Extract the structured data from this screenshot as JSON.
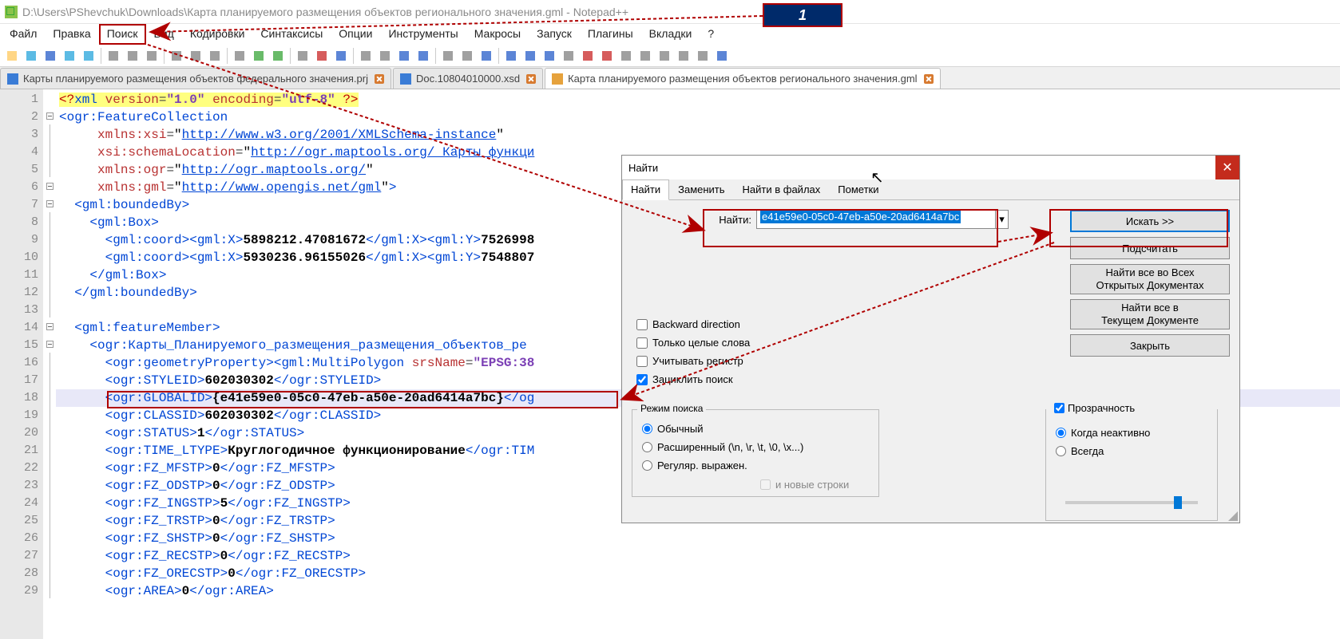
{
  "title": "D:\\Users\\PShevchuk\\Downloads\\Карта планируемого размещения объектов регионального значения.gml - Notepad++",
  "callout_label": "1",
  "menubar": [
    "Файл",
    "Правка",
    "Поиск",
    "Вид",
    "Кодировки",
    "Синтаксисы",
    "Опции",
    "Инструменты",
    "Макросы",
    "Запуск",
    "Плагины",
    "Вкладки",
    "?"
  ],
  "tabs": [
    {
      "label": "Карты планируемого размещения объектов федерального значения.prj",
      "active": false,
      "icon": "blue"
    },
    {
      "label": "Doc.10804010000.xsd",
      "active": false,
      "icon": "blue"
    },
    {
      "label": "Карта планируемого размещения объектов регионального значения.gml",
      "active": true,
      "icon": "orange"
    }
  ],
  "code": {
    "lines": [
      {
        "n": 1,
        "html": "<span class='t-pi-bg'><span class='t-pi'>&lt;?</span><span class='t-tag'>xml</span> <span class='t-attr'>version</span><span class='t-eq'>=</span><span class='t-str'>\"1.0\"</span> <span class='t-attr'>encoding</span><span class='t-eq'>=</span><span class='t-str'>\"utf-8\"</span> <span class='t-pi'>?&gt;</span></span>"
      },
      {
        "n": 2,
        "html": "<span class='t-tag'>&lt;ogr:FeatureCollection</span>"
      },
      {
        "n": 3,
        "html": "     <span class='t-attr'>xmlns:xsi</span><span class='t-eq'>=</span>\"<span class='t-url'>http://www.w3.org/2001/XMLSchema-instance</span>\""
      },
      {
        "n": 4,
        "html": "     <span class='t-attr'>xsi:schemaLocation</span><span class='t-eq'>=</span>\"<span class='t-url'>http://ogr.maptools.org/ Карты функци</span>"
      },
      {
        "n": 5,
        "html": "     <span class='t-attr'>xmlns:ogr</span><span class='t-eq'>=</span>\"<span class='t-url'>http://ogr.maptools.org/</span>\""
      },
      {
        "n": 6,
        "html": "     <span class='t-attr'>xmlns:gml</span><span class='t-eq'>=</span>\"<span class='t-url'>http://www.opengis.net/gml</span>\"<span class='t-tag'>&gt;</span>"
      },
      {
        "n": 7,
        "html": "  <span class='t-tag'>&lt;gml:boundedBy&gt;</span>"
      },
      {
        "n": 8,
        "html": "    <span class='t-tag'>&lt;gml:Box&gt;</span>"
      },
      {
        "n": 9,
        "html": "      <span class='t-tag'>&lt;gml:coord&gt;&lt;gml:X&gt;</span><span class='t-txt-b'>5898212.47081672</span><span class='t-tag'>&lt;/gml:X&gt;&lt;gml:Y&gt;</span><span class='t-txt-b'>7526998</span>"
      },
      {
        "n": 10,
        "html": "      <span class='t-tag'>&lt;gml:coord&gt;&lt;gml:X&gt;</span><span class='t-txt-b'>5930236.96155026</span><span class='t-tag'>&lt;/gml:X&gt;&lt;gml:Y&gt;</span><span class='t-txt-b'>7548807</span>"
      },
      {
        "n": 11,
        "html": "    <span class='t-tag'>&lt;/gml:Box&gt;</span>"
      },
      {
        "n": 12,
        "html": "  <span class='t-tag'>&lt;/gml:boundedBy&gt;</span>"
      },
      {
        "n": 13,
        "html": ""
      },
      {
        "n": 14,
        "html": "  <span class='t-tag'>&lt;gml:featureMember&gt;</span>"
      },
      {
        "n": 15,
        "html": "    <span class='t-tag'>&lt;ogr:Карты_Планируемого_размещения_размещения_объектов_ре</span>"
      },
      {
        "n": 16,
        "html": "      <span class='t-tag'>&lt;ogr:geometryProperty&gt;&lt;gml:MultiPolygon</span> <span class='t-attr'>srsName</span><span class='t-eq'>=</span><span class='t-str'>\"EPSG:38</span>"
      },
      {
        "n": 17,
        "html": "      <span class='t-tag'>&lt;ogr:STYLEID&gt;</span><span class='t-txt-b'>602030302</span><span class='t-tag'>&lt;/ogr:STYLEID&gt;</span>"
      },
      {
        "n": 18,
        "html": "      <span class='t-tag'>&lt;ogr:GLOBALID&gt;</span><span class='t-txt-b'>{e41e59e0-05c0-47eb-a50e-20ad6414a7bc}</span><span class='t-tag'>&lt;/og</span>"
      },
      {
        "n": 19,
        "html": "      <span class='t-tag'>&lt;ogr:CLASSID&gt;</span><span class='t-txt-b'>602030302</span><span class='t-tag'>&lt;/ogr:CLASSID&gt;</span>"
      },
      {
        "n": 20,
        "html": "      <span class='t-tag'>&lt;ogr:STATUS&gt;</span><span class='t-txt-b'>1</span><span class='t-tag'>&lt;/ogr:STATUS&gt;</span>"
      },
      {
        "n": 21,
        "html": "      <span class='t-tag'>&lt;ogr:TIME_LTYPE&gt;</span><span class='t-txt-b'>Круглогодичное функционирование</span><span class='t-tag'>&lt;/ogr:TIM</span>"
      },
      {
        "n": 22,
        "html": "      <span class='t-tag'>&lt;ogr:FZ_MFSTP&gt;</span><span class='t-txt-b'>0</span><span class='t-tag'>&lt;/ogr:FZ_MFSTP&gt;</span>"
      },
      {
        "n": 23,
        "html": "      <span class='t-tag'>&lt;ogr:FZ_ODSTP&gt;</span><span class='t-txt-b'>0</span><span class='t-tag'>&lt;/ogr:FZ_ODSTP&gt;</span>"
      },
      {
        "n": 24,
        "html": "      <span class='t-tag'>&lt;ogr:FZ_INGSTP&gt;</span><span class='t-txt-b'>5</span><span class='t-tag'>&lt;/ogr:FZ_INGSTP&gt;</span>"
      },
      {
        "n": 25,
        "html": "      <span class='t-tag'>&lt;ogr:FZ_TRSTP&gt;</span><span class='t-txt-b'>0</span><span class='t-tag'>&lt;/ogr:FZ_TRSTP&gt;</span>"
      },
      {
        "n": 26,
        "html": "      <span class='t-tag'>&lt;ogr:FZ_SHSTP&gt;</span><span class='t-txt-b'>0</span><span class='t-tag'>&lt;/ogr:FZ_SHSTP&gt;</span>"
      },
      {
        "n": 27,
        "html": "      <span class='t-tag'>&lt;ogr:FZ_RECSTP&gt;</span><span class='t-txt-b'>0</span><span class='t-tag'>&lt;/ogr:FZ_RECSTP&gt;</span>"
      },
      {
        "n": 28,
        "html": "      <span class='t-tag'>&lt;ogr:FZ_ORECSTP&gt;</span><span class='t-txt-b'>0</span><span class='t-tag'>&lt;/ogr:FZ_ORECSTP&gt;</span>"
      },
      {
        "n": 29,
        "html": "      <span class='t-tag'>&lt;ogr:AREA&gt;</span><span class='t-txt-b'>0</span><span class='t-tag'>&lt;/ogr:AREA&gt;</span>"
      }
    ],
    "fold_lines": [
      6,
      7,
      2,
      14,
      15
    ],
    "highlighted_line": 18
  },
  "find": {
    "title": "Найти",
    "tabs": [
      "Найти",
      "Заменить",
      "Найти в файлах",
      "Пометки"
    ],
    "active_tab": 0,
    "find_label": "Найти:",
    "find_value": "e41e59e0-05c0-47eb-a50e-20ad6414a7bc",
    "buttons": {
      "search": "Искать >>",
      "count": "Подсчитать",
      "find_all_open": "Найти все во Всех\nОткрытых Документах",
      "find_all_current": "Найти все в\nТекущем Документе",
      "close": "Закрыть"
    },
    "checks": {
      "backward": "Backward direction",
      "whole_word": "Только целые слова",
      "match_case": "Учитывать регистр",
      "wrap": "Зациклить поиск"
    },
    "mode_legend": "Режим поиска",
    "modes": {
      "normal": "Обычный",
      "extended": "Расширенный (\\n, \\r, \\t, \\0, \\x...)",
      "regex": "Регуляр. выражен."
    },
    "newlines_label": "и новые строки",
    "transparency": {
      "label": "Прозрачность",
      "when_inactive": "Когда неактивно",
      "always": "Всегда"
    }
  }
}
